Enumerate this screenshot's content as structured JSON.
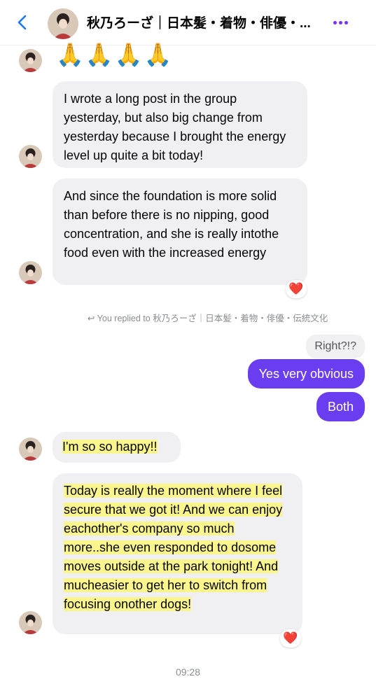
{
  "header": {
    "title": "秋乃ろーざ｜日本髪・着物・俳優・...",
    "accent_color": "#7b2ff7"
  },
  "messages": {
    "emoji": "🙏🙏🙏🙏",
    "m1": "I wrote a long post in the group yesterday, but also big change from yesterday because I brought the energy level up quite a bit today!",
    "m2": "And since the foundation is more solid than before there is no nipping, good concentration, and she is really intothe food even with the increased energy",
    "m2_reaction": "❤️",
    "replied_note": "You replied to 秋乃ろーざ｜日本髪・着物・俳優・伝統文化",
    "quoted": "Right?!?",
    "out1": "Yes very obvious",
    "out2": "Both",
    "m3": "I'm so so happy!!",
    "m4": "Today is really the moment where I feel secure that we got it! And we can enjoy eachother's company so much more..she even responded to dosome moves outside at the park tonight! And mucheasier to get her to switch from focusing onother dogs!",
    "m4_reaction": "❤️",
    "timestamp": "09:28"
  },
  "colors": {
    "outgoing": "#6a3df0",
    "incoming": "#f0f0f2",
    "highlight": "#faf58c"
  }
}
